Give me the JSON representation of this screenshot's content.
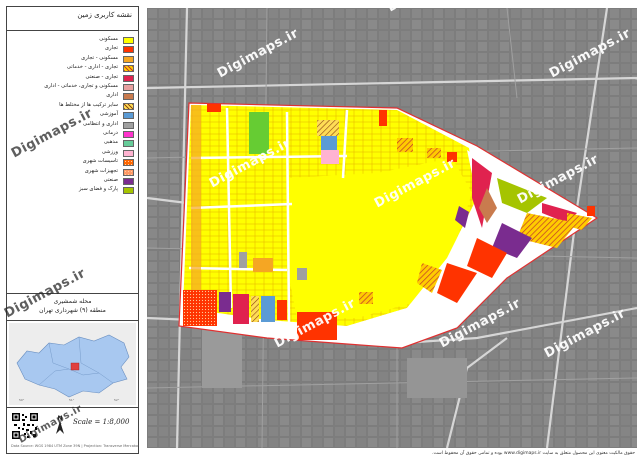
{
  "legend": {
    "title": "نقشه کاربری زمین",
    "items": [
      {
        "label": "مسکونی",
        "color": "#ffff00",
        "hatch": ""
      },
      {
        "label": "تجاری",
        "color": "#ff3300",
        "hatch": ""
      },
      {
        "label": "مسکونی - تجاری",
        "color": "#f5a623",
        "hatch": ""
      },
      {
        "label": "تجاری - اداری - خدماتی",
        "color": "#ffcc00",
        "hatch": "#c0392b"
      },
      {
        "label": "تجاری - صنعتی",
        "color": "#e0224f",
        "hatch": ""
      },
      {
        "label": "مسکونی و تجاری، خدماتی - اداری",
        "color": "#e8a0a0",
        "hatch": ""
      },
      {
        "label": "اداری",
        "color": "#c97b4e",
        "hatch": ""
      },
      {
        "label": "سایر ترکیب ها از مختلط ها",
        "color": "#ffdd55",
        "hatch": "#8b4513"
      },
      {
        "label": "آموزشی",
        "color": "#5b9bd5",
        "hatch": ""
      },
      {
        "label": "اداری و انتظامی",
        "color": "#a0a0a0",
        "hatch": ""
      },
      {
        "label": "درمانی",
        "color": "#ff33cc",
        "hatch": ""
      },
      {
        "label": "مذهبی",
        "color": "#66cc99",
        "hatch": ""
      },
      {
        "label": "ورزشی",
        "color": "#ffb3d1",
        "hatch": ""
      },
      {
        "label": "تاسیسات شهری",
        "color": "#ff6600",
        "hatch": "dots"
      },
      {
        "label": "تجهیزات شهری",
        "color": "#ff9966",
        "hatch": "dots"
      },
      {
        "label": "صنعتی",
        "color": "#7a2c8f",
        "hatch": ""
      },
      {
        "label": "پارک و فضای سبز",
        "color": "#a5c400",
        "hatch": ""
      }
    ]
  },
  "district": {
    "line1": "محله شمشیری",
    "line2": "منطقه (۹) شهرداری تهران"
  },
  "scale": "Scale = 1:8,000",
  "credits": "Data Source: WGS 1984 UTM Zone 39N | Projection: Transverse Mercator",
  "watermark": "Digimaps.ir",
  "footer": "حقوق مالکیت معنوی این محصول متعلق به سایت www.digimaps.ir بوده و تمامی حقوق آن محفوظ است.",
  "colors": {
    "street": "#7b7b7b",
    "block": "#8e8e8e",
    "road_line": "#cfcfcf",
    "boundary": "#e03030",
    "inset_region": "#a8c8f0",
    "inset_district": "#e04040"
  }
}
